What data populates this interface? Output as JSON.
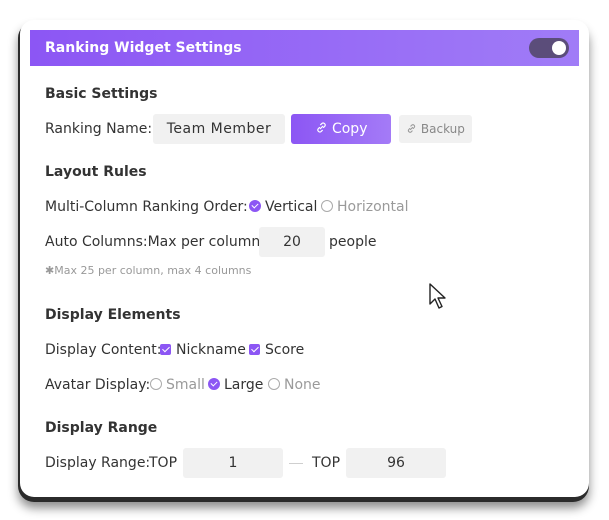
{
  "header": {
    "title": "Ranking Widget Settings",
    "toggle_on": true,
    "accent_color": "#8c56f4"
  },
  "basic": {
    "title": "Basic Settings",
    "name_label": "Ranking Name:",
    "name_value": "Team Member",
    "copy_label": "Copy",
    "copy_icon": "link-icon",
    "backup_label": "Backup",
    "backup_icon": "link-icon"
  },
  "layout": {
    "title": "Layout Rules",
    "order_label": "Multi-Column Ranking Order:",
    "order_options": [
      {
        "label": "Vertical",
        "selected": true
      },
      {
        "label": "Horizontal",
        "selected": false
      }
    ],
    "auto_label": "Auto Columns:Max per column",
    "auto_value": "20",
    "auto_unit": "people",
    "note": "✱Max 25 per column, max 4 columns"
  },
  "display": {
    "title": "Display Elements",
    "content_label": "Display Content:",
    "content_options": [
      {
        "label": "Nickname",
        "checked": true
      },
      {
        "label": "Score",
        "checked": true
      }
    ],
    "avatar_label": "Avatar Display:",
    "avatar_options": [
      {
        "label": "Small",
        "selected": false
      },
      {
        "label": "Large",
        "selected": true
      },
      {
        "label": "None",
        "selected": false
      }
    ]
  },
  "range": {
    "title": "Display Range",
    "label": "Display Range:",
    "from_prefix": "TOP",
    "from_value": "1",
    "to_prefix": "TOP",
    "to_value": "96"
  }
}
